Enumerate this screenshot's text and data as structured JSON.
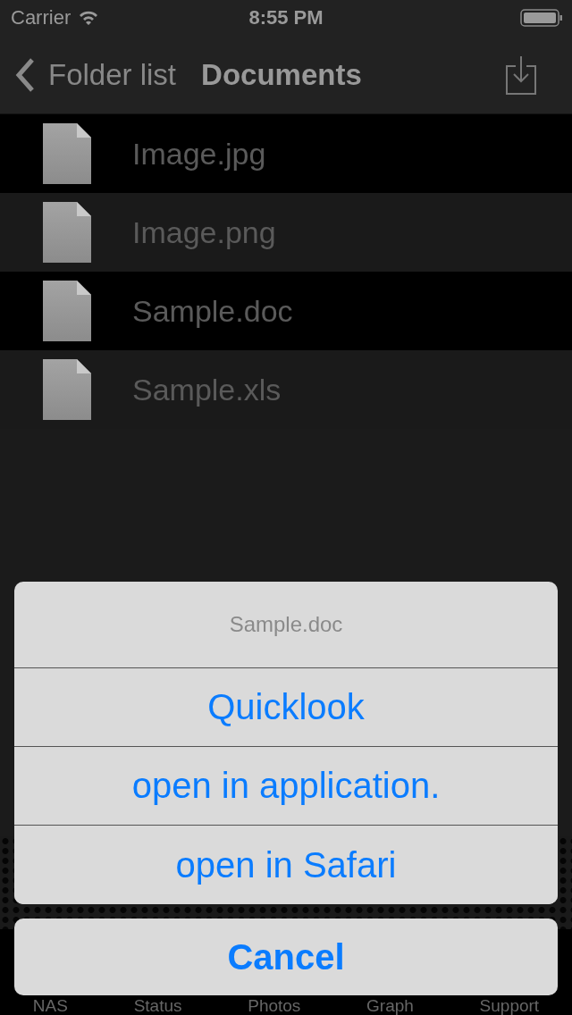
{
  "status_bar": {
    "carrier": "Carrier",
    "time": "8:55 PM"
  },
  "nav": {
    "back": "Folder list",
    "title": "Documents"
  },
  "files": [
    {
      "name": "Image.jpg"
    },
    {
      "name": "Image.png"
    },
    {
      "name": "Sample.doc"
    },
    {
      "name": "Sample.xls"
    }
  ],
  "tab_bar": [
    "NAS",
    "Status",
    "Photos",
    "Graph",
    "Support"
  ],
  "action_sheet": {
    "title": "Sample.doc",
    "actions": [
      "Quicklook",
      "open in application.",
      "open in Safari"
    ],
    "cancel": "Cancel"
  }
}
